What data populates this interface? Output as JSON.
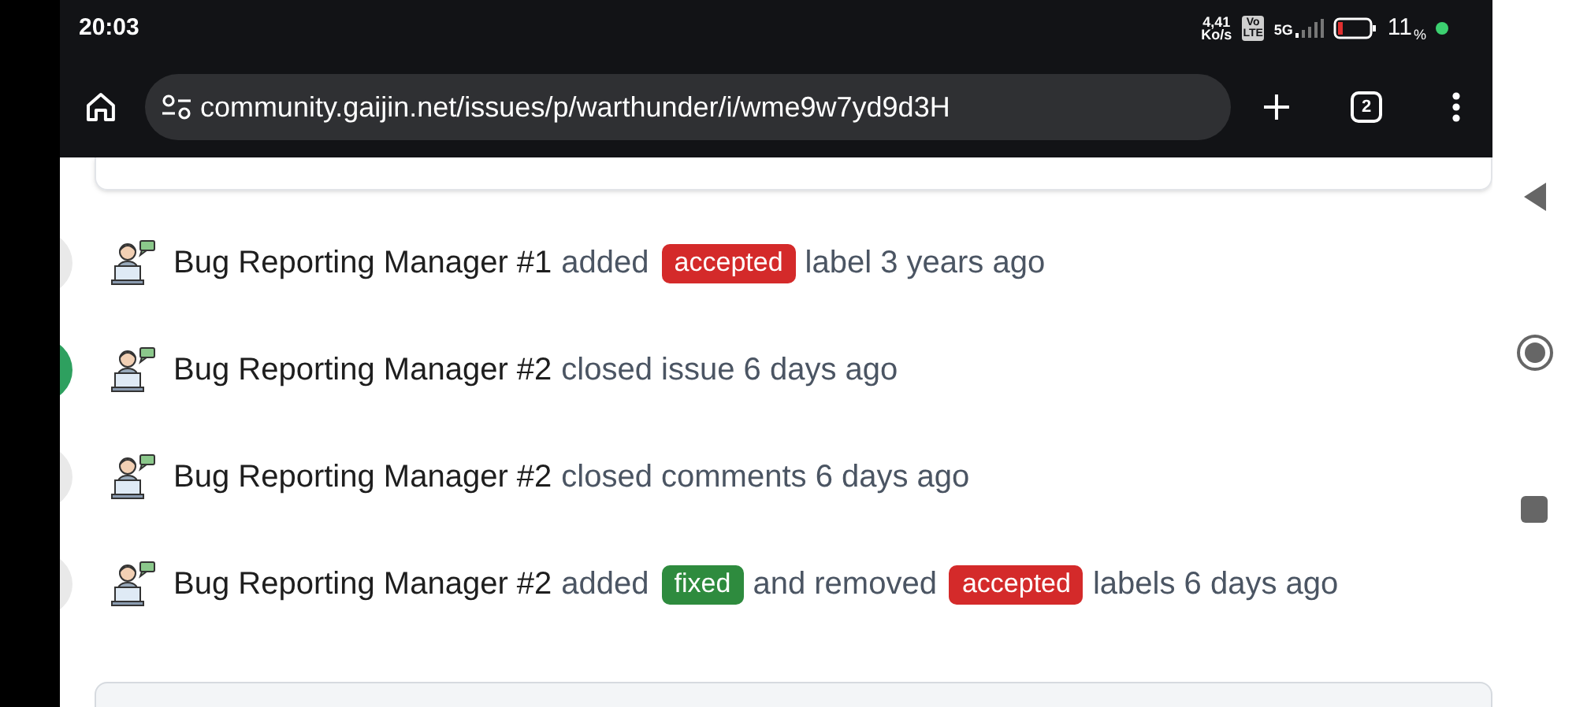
{
  "status_bar": {
    "time": "20:03",
    "net_speed": "4,41",
    "net_unit": "Ko/s",
    "volte_top": "Vo",
    "volte_bottom": "LTE",
    "network": "5G",
    "battery": "11",
    "battery_unit": "%"
  },
  "browser": {
    "url": "community.gaijin.net/issues/p/warthunder/i/wme9w7yd9d3H",
    "tab_count": "2"
  },
  "events": [
    {
      "color": "#e9e9e9",
      "actor": "Bug Reporting Manager #1",
      "parts": [
        {
          "kind": "text",
          "text": "added"
        },
        {
          "kind": "label",
          "text": "accepted",
          "color": "#d42a2a"
        },
        {
          "kind": "text",
          "text": "label 3 years ago"
        }
      ]
    },
    {
      "color": "#2ea05f",
      "actor": "Bug Reporting Manager #2",
      "parts": [
        {
          "kind": "text",
          "text": "closed issue 6 days ago"
        }
      ]
    },
    {
      "color": "#e9e9e9",
      "actor": "Bug Reporting Manager #2",
      "parts": [
        {
          "kind": "text",
          "text": "closed comments 6 days ago"
        }
      ]
    },
    {
      "color": "#e9e9e9",
      "actor": "Bug Reporting Manager #2",
      "parts": [
        {
          "kind": "text",
          "text": "added"
        },
        {
          "kind": "label",
          "text": "fixed",
          "color": "#2e8b3e"
        },
        {
          "kind": "text",
          "text": "and removed"
        },
        {
          "kind": "label",
          "text": "accepted",
          "color": "#d42a2a"
        },
        {
          "kind": "text",
          "text": "labels 6 days ago"
        }
      ]
    }
  ]
}
